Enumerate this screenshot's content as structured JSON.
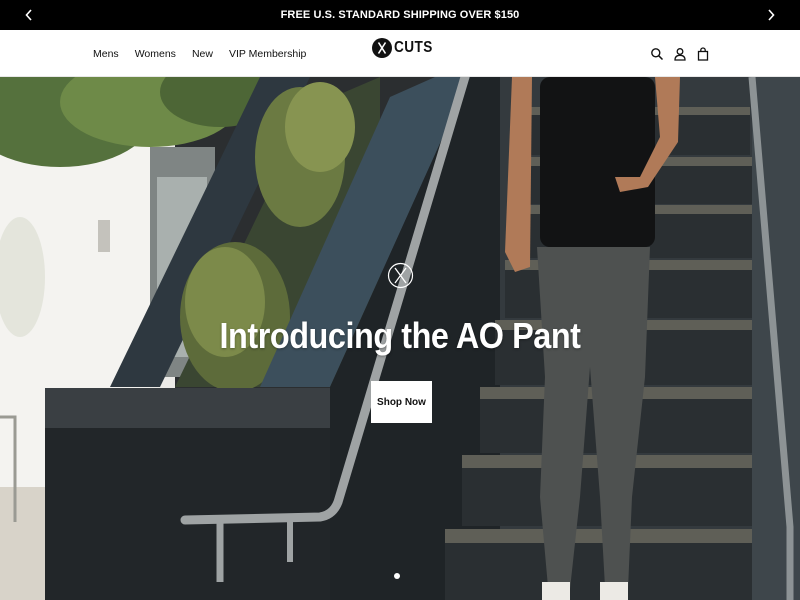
{
  "announcement": {
    "text": "FREE U.S. STANDARD SHIPPING OVER $150",
    "prev_icon": "chevron-left-icon",
    "next_icon": "chevron-right-icon"
  },
  "header": {
    "nav": [
      {
        "label": "Mens"
      },
      {
        "label": "Womens"
      },
      {
        "label": "New"
      },
      {
        "label": "VIP Membership"
      }
    ],
    "logo_text": "CUTS",
    "icons": [
      "search-icon",
      "account-icon",
      "cart-icon"
    ]
  },
  "hero": {
    "title": "Introducing the AO Pant",
    "cta_label": "Shop Now",
    "slide_indicator": {
      "count": 1,
      "active": 1
    }
  },
  "colors": {
    "announcement_bg": "#000000",
    "text": "#111111",
    "cta_bg": "#ffffff"
  }
}
